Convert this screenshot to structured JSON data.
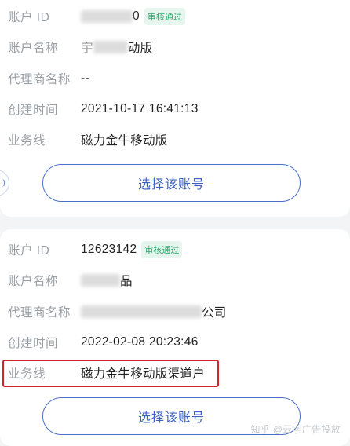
{
  "accounts": [
    {
      "fields": {
        "account_id_label": "账户 ID",
        "account_id_prefix": "",
        "account_id_suffix": "0",
        "status_badge": "审核通过",
        "account_name_label": "账户名称",
        "account_name_prefix": "宇",
        "account_name_suffix": "动版",
        "agent_name_label": "代理商名称",
        "agent_name": "--",
        "created_time_label": "创建时间",
        "created_time": "2021-10-17 16:41:13",
        "business_line_label": "业务线",
        "business_line": "磁力金牛移动版"
      },
      "select_button": "选择该账号"
    },
    {
      "fields": {
        "account_id_label": "账户 ID",
        "account_id": "12623142",
        "status_badge": "审核通过",
        "account_name_label": "账户名称",
        "account_name_prefix": "",
        "account_name_suffix": "品",
        "agent_name_label": "代理商名称",
        "agent_name_suffix": "公司",
        "created_time_label": "创建时间",
        "created_time": "2022-02-08 20:23:46",
        "business_line_label": "业务线",
        "business_line": "磁力金牛移动版渠道户"
      },
      "select_button": "选择该账号"
    }
  ],
  "watermark": "知乎 @云字广告投放",
  "colors": {
    "accent": "#3c63c4",
    "badge_text": "#2aa56b",
    "badge_bg": "#e6f6ee",
    "highlight": "#d1232a"
  }
}
